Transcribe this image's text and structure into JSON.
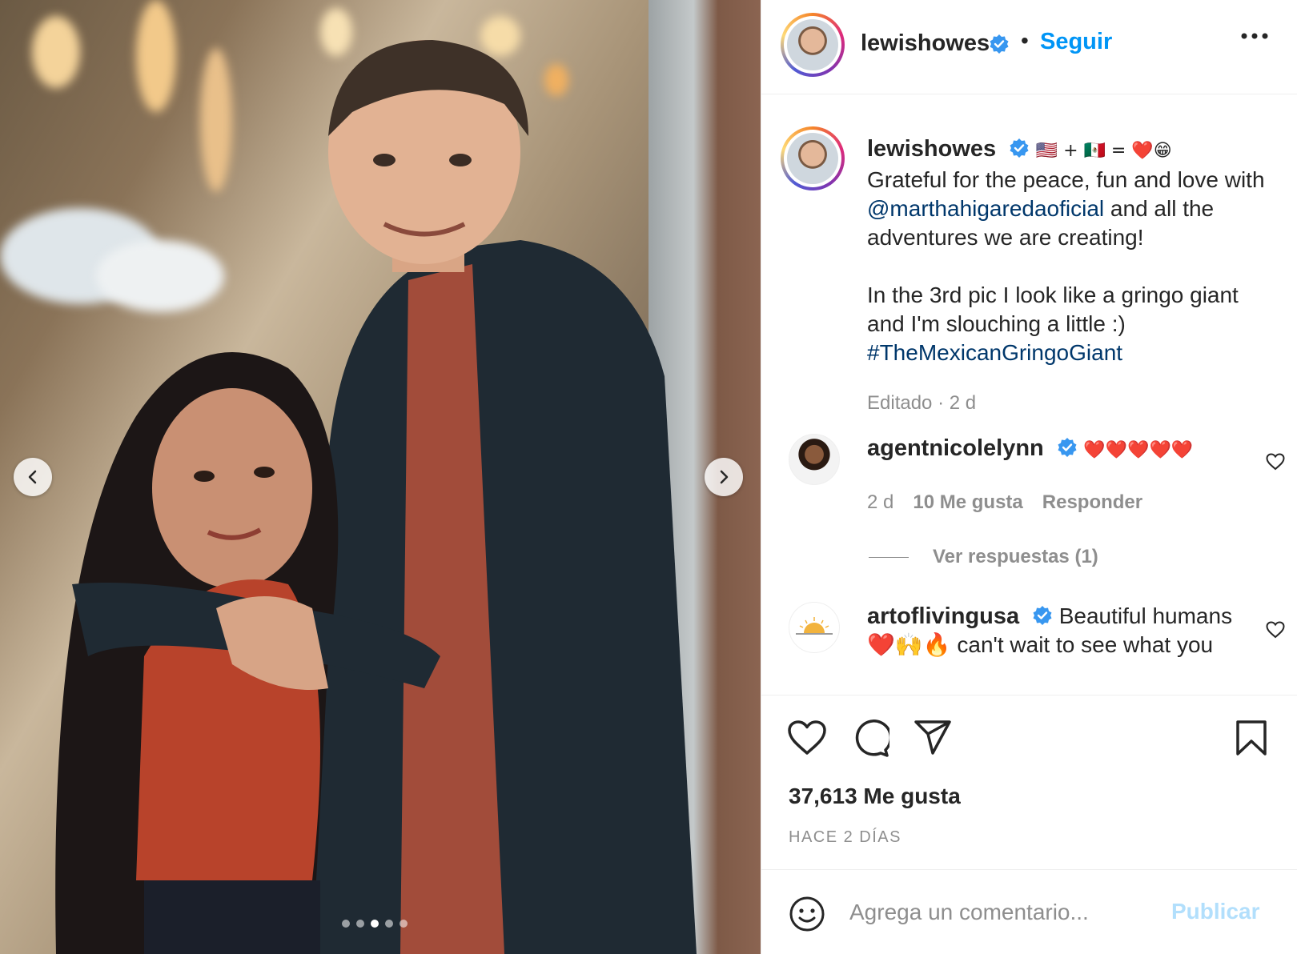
{
  "post": {
    "author": "lewishowes",
    "follow_label": "Seguir",
    "separator": "•"
  },
  "caption": {
    "username": "lewishowes",
    "emojis": "🇺🇸 + 🇲🇽 = ❤️😁",
    "line1": "Grateful for the peace, fun and love with ",
    "mention": "@marthahigaredaoficial",
    "line2": " and all the adventures we are creating!",
    "line3": "In the 3rd pic I look like a gringo giant and I'm slouching a little :)",
    "hashtag": "#TheMexicanGringoGiant",
    "meta": "Editado · 2 d"
  },
  "comments": [
    {
      "username": "agentnicolelynn",
      "text": "❤️❤️❤️❤️❤️",
      "time": "2 d",
      "likes": "10 Me gusta",
      "reply": "Responder",
      "view_replies": "Ver respuestas (1)"
    },
    {
      "username": "artoflivingusa",
      "text": "Beautiful humans ❤️🙌🔥 can't wait to see what you"
    }
  ],
  "engagement": {
    "likes": "37,613 Me gusta",
    "time_ago": "HACE 2 DÍAS"
  },
  "composer": {
    "placeholder": "Agrega un comentario...",
    "publish_label": "Publicar"
  },
  "carousel": {
    "total": 5,
    "active_index": 2
  },
  "colors": {
    "accent": "#0095f6",
    "mention": "#00376b",
    "muted": "#8e8e8e",
    "verified": "#3897f0"
  },
  "icons": {
    "verified": "verified-badge-icon",
    "more": "more-options-icon",
    "like": "heart-icon",
    "comment": "comment-icon",
    "share": "share-icon",
    "save": "bookmark-icon",
    "emoji": "emoji-icon",
    "prev": "chevron-left-icon",
    "next": "chevron-right-icon"
  }
}
